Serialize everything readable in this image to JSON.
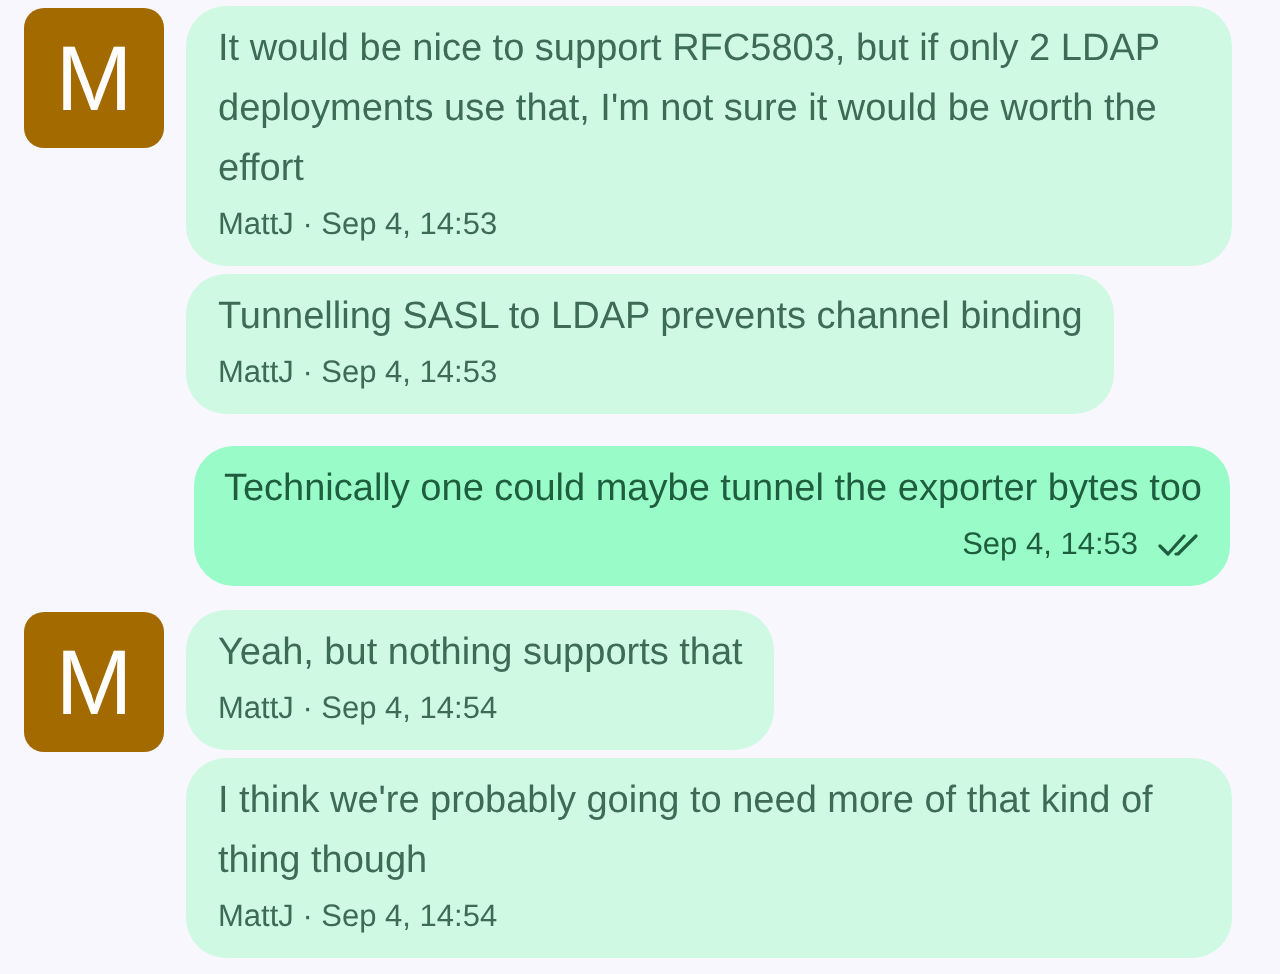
{
  "groups": [
    {
      "kind": "incoming",
      "avatar": "M",
      "messages": [
        {
          "text": "It would be nice to support RFC5803, but if only 2 LDAP deployments use that, I'm not sure it would be worth the effort",
          "meta": "MattJ · Sep 4, 14:53"
        },
        {
          "text": "Tunnelling SASL to LDAP prevents channel binding",
          "meta": "MattJ · Sep 4, 14:53"
        }
      ]
    },
    {
      "kind": "outgoing",
      "messages": [
        {
          "text": "Technically one could maybe tunnel the exporter bytes too",
          "meta": "Sep 4, 14:53"
        }
      ]
    },
    {
      "kind": "incoming",
      "avatar": "M",
      "messages": [
        {
          "text": "Yeah, but nothing supports that",
          "meta": "MattJ · Sep 4, 14:54"
        },
        {
          "text": "I think we're probably going to need more of that kind of thing though",
          "meta": "MattJ · Sep 4, 14:54"
        }
      ]
    }
  ]
}
